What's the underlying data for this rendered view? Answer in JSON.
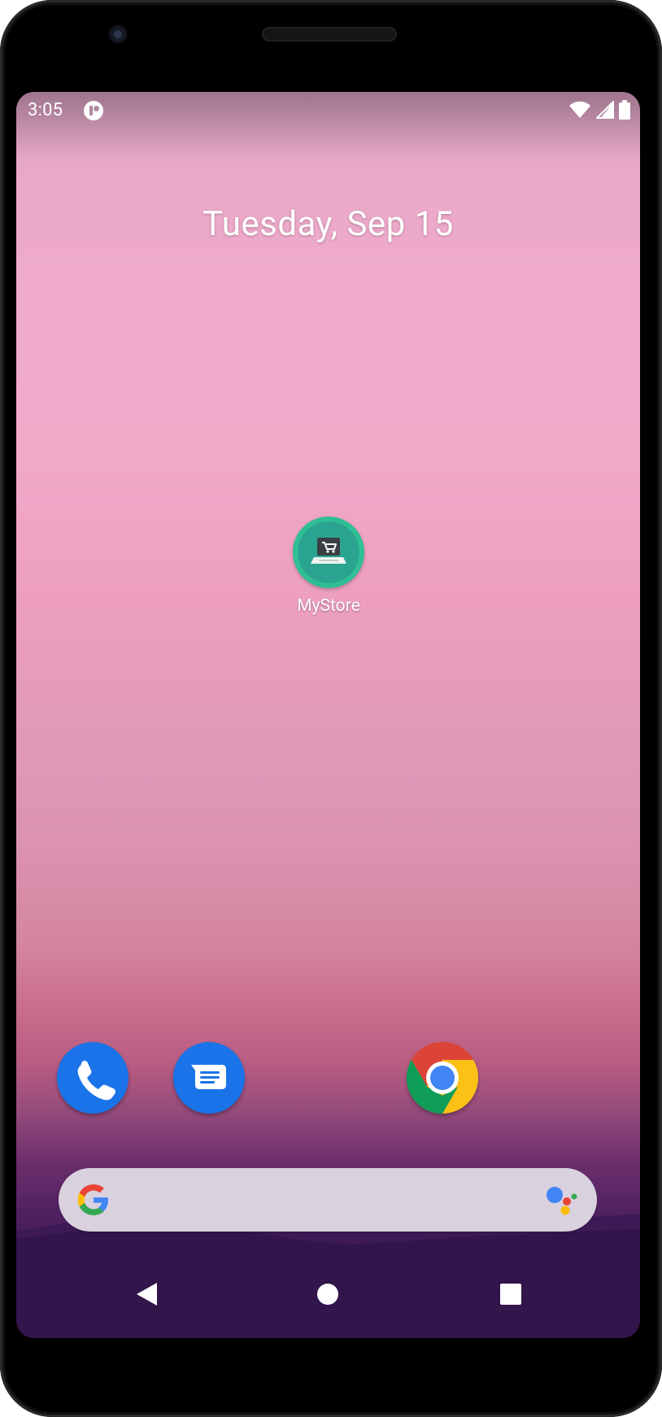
{
  "status_bar": {
    "time": "3:05",
    "icons": [
      "notification-app-icon",
      "wifi-icon",
      "cell-signal-icon",
      "battery-icon"
    ]
  },
  "home": {
    "date": "Tuesday, Sep 15",
    "apps": [
      {
        "label": "MyStore",
        "icon": "store-laptop-cart-icon"
      }
    ]
  },
  "dock": {
    "apps": [
      {
        "name": "Phone",
        "icon": "phone-icon",
        "color": "#1a73e8"
      },
      {
        "name": "Messages",
        "icon": "messages-icon",
        "color": "#1a73e8"
      },
      {
        "name": "Chrome",
        "icon": "chrome-icon",
        "color": "#db4437"
      }
    ]
  },
  "search": {
    "placeholder": "",
    "logo": "google-g-icon",
    "assistant": "google-assistant-icon"
  },
  "navigation": {
    "buttons": [
      "back-icon",
      "home-icon",
      "recents-icon"
    ]
  },
  "colors": {
    "accent_phone": "#1a73e8",
    "mystore_ring": "#2fbf94",
    "search_bg": "#d9d1dd"
  }
}
